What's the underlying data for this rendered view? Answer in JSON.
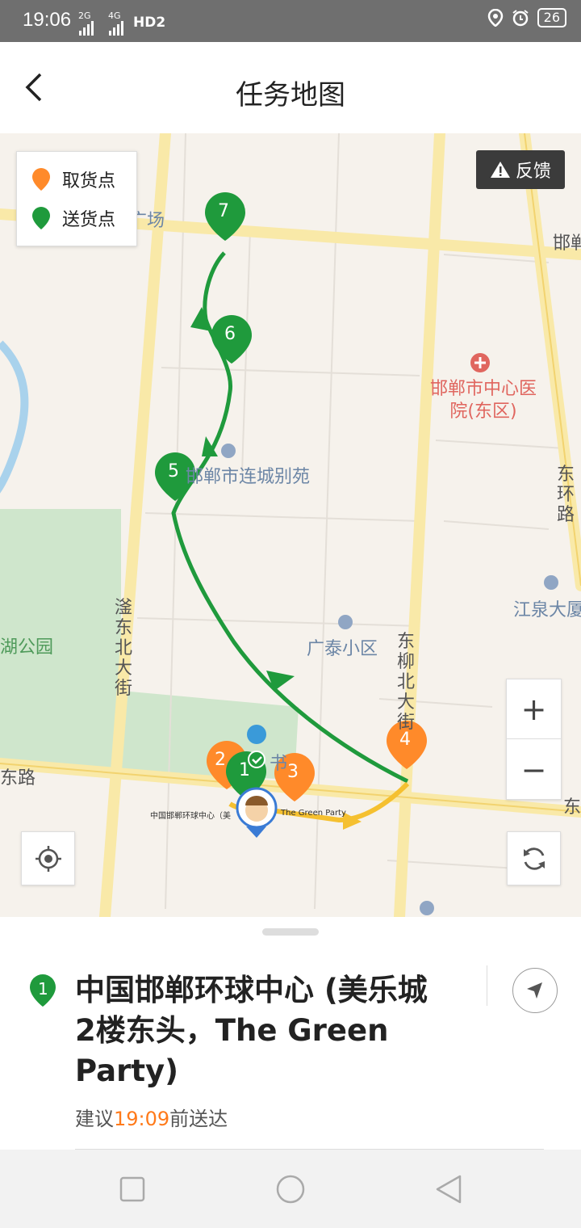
{
  "status_bar": {
    "time": "19:06",
    "signal_1": "2G",
    "signal_2": "4G",
    "hd": "HD2",
    "battery": "26"
  },
  "header": {
    "title": "任务地图"
  },
  "legend": {
    "pickup_label": "取货点",
    "delivery_label": "送货点",
    "pickup_color": "#ff8a2a",
    "delivery_color": "#1f9a3c"
  },
  "feedback": {
    "label": "反馈"
  },
  "map": {
    "poi_hospital": "邯郸市中心医院(东区)",
    "poi_villa": "邯郸市连城别苑",
    "poi_guangtai": "广泰小区",
    "poi_jiangquan": "江泉大厦",
    "poi_park": "龙湖公园",
    "road_east_ring": "东环路",
    "road_fuyang": "滏东北大街",
    "road_dongliu": "东柳北大街",
    "road_left_bottom": "东路",
    "road_top_right": "邯郸",
    "road_right_bottom": "东",
    "poi_top_left": "广场",
    "poi_mall_short": "书",
    "small_label_mall": "中国邯郸环球中心（美",
    "small_label_party": "The Green Party",
    "markers": [
      "1",
      "2",
      "3",
      "4",
      "5",
      "6",
      "7"
    ],
    "route_color_green": "#1f9a3c",
    "route_color_yellow": "#f5c030"
  },
  "controls": {
    "zoom_in": "+",
    "zoom_out": "−"
  },
  "sheet": {
    "stop_number": "1",
    "address": "中国邯郸环球中心 (美乐城2楼东头，The  Green Party)",
    "eta_prefix": "建议",
    "eta_time": "19:09",
    "eta_suffix": "前送达"
  }
}
